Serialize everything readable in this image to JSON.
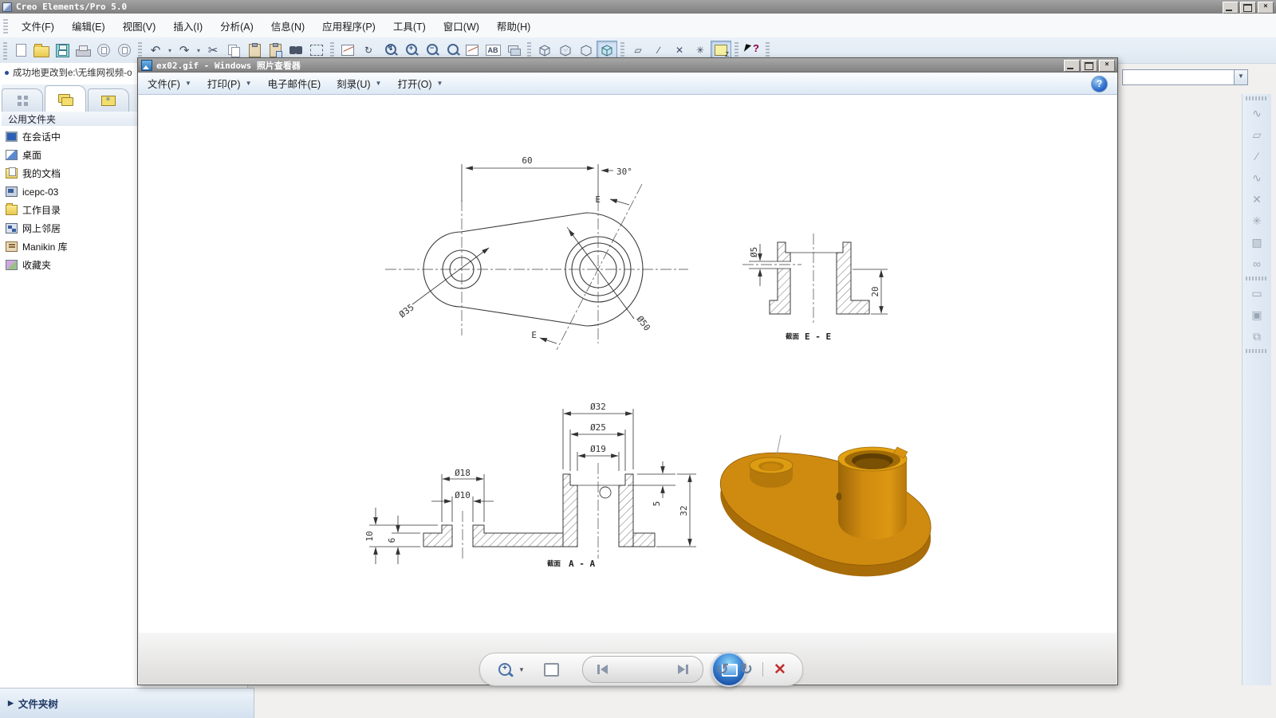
{
  "creo": {
    "window_title": "Creo Elements/Pro 5.0",
    "menus": [
      "文件(F)",
      "编辑(E)",
      "视图(V)",
      "插入(I)",
      "分析(A)",
      "信息(N)",
      "应用程序(P)",
      "工具(T)",
      "窗口(W)",
      "帮助(H)"
    ],
    "status_message": "成功地更改到e:\\无维网视频-o",
    "toolbar_glyphs": {
      "undo": "↶",
      "redo": "↷",
      "cut": "✂",
      "spin": "↻",
      "saved_views": "AB",
      "caret": "▾"
    },
    "sidebar": {
      "folder_header": "公用文件夹",
      "items": [
        {
          "label": "在会话中"
        },
        {
          "label": "桌面"
        },
        {
          "label": "我的文档"
        },
        {
          "label": "icepc-03"
        },
        {
          "label": "工作目录"
        },
        {
          "label": "网上邻居"
        },
        {
          "label": "Manikin 库"
        },
        {
          "label": "收藏夹"
        }
      ]
    },
    "folder_tree_label": "文件夹树",
    "folder_tree_arrow": "▶",
    "right_toolbar_glyphs": [
      "∿",
      "▱",
      "∕",
      "∿",
      "✕",
      "✳",
      "▨",
      "∞",
      "▭",
      "▣",
      "⧉"
    ]
  },
  "photo_viewer": {
    "window_title": "ex02.gif - Windows 照片查看器",
    "menus": [
      {
        "label": "文件(F)"
      },
      {
        "label": "打印(P)"
      },
      {
        "label": "电子邮件(E)"
      },
      {
        "label": "刻录(U)"
      },
      {
        "label": "打开(O)"
      }
    ],
    "help_glyph": "?",
    "controls": {
      "rotate_ccw": "↺",
      "rotate_cw": "↻",
      "delete": "✕"
    }
  },
  "drawing": {
    "top_view": {
      "dim_width": "60",
      "dim_angle": "30°",
      "dim_left_boss": "Ø35",
      "dim_right_boss": "Ø50",
      "section_letter_top": "E",
      "section_letter_bottom": "E"
    },
    "section_ee": {
      "caption_prefix": "截面",
      "caption": "E - E",
      "dim_hole": "Ø5",
      "dim_height": "20"
    },
    "section_aa": {
      "caption_prefix": "截面",
      "caption": "A - A",
      "dim_d32": "Ø32",
      "dim_d25": "Ø25",
      "dim_d19": "Ø19",
      "dim_d18": "Ø18",
      "dim_d10": "Ø10",
      "dim_h10": "10",
      "dim_h6": "6",
      "dim_h5": "5",
      "dim_h32": "32"
    },
    "part_colors": {
      "main": "#cf8a10",
      "dark": "#a86c08",
      "light": "#e2a012",
      "bore": "#5f3e03"
    }
  }
}
